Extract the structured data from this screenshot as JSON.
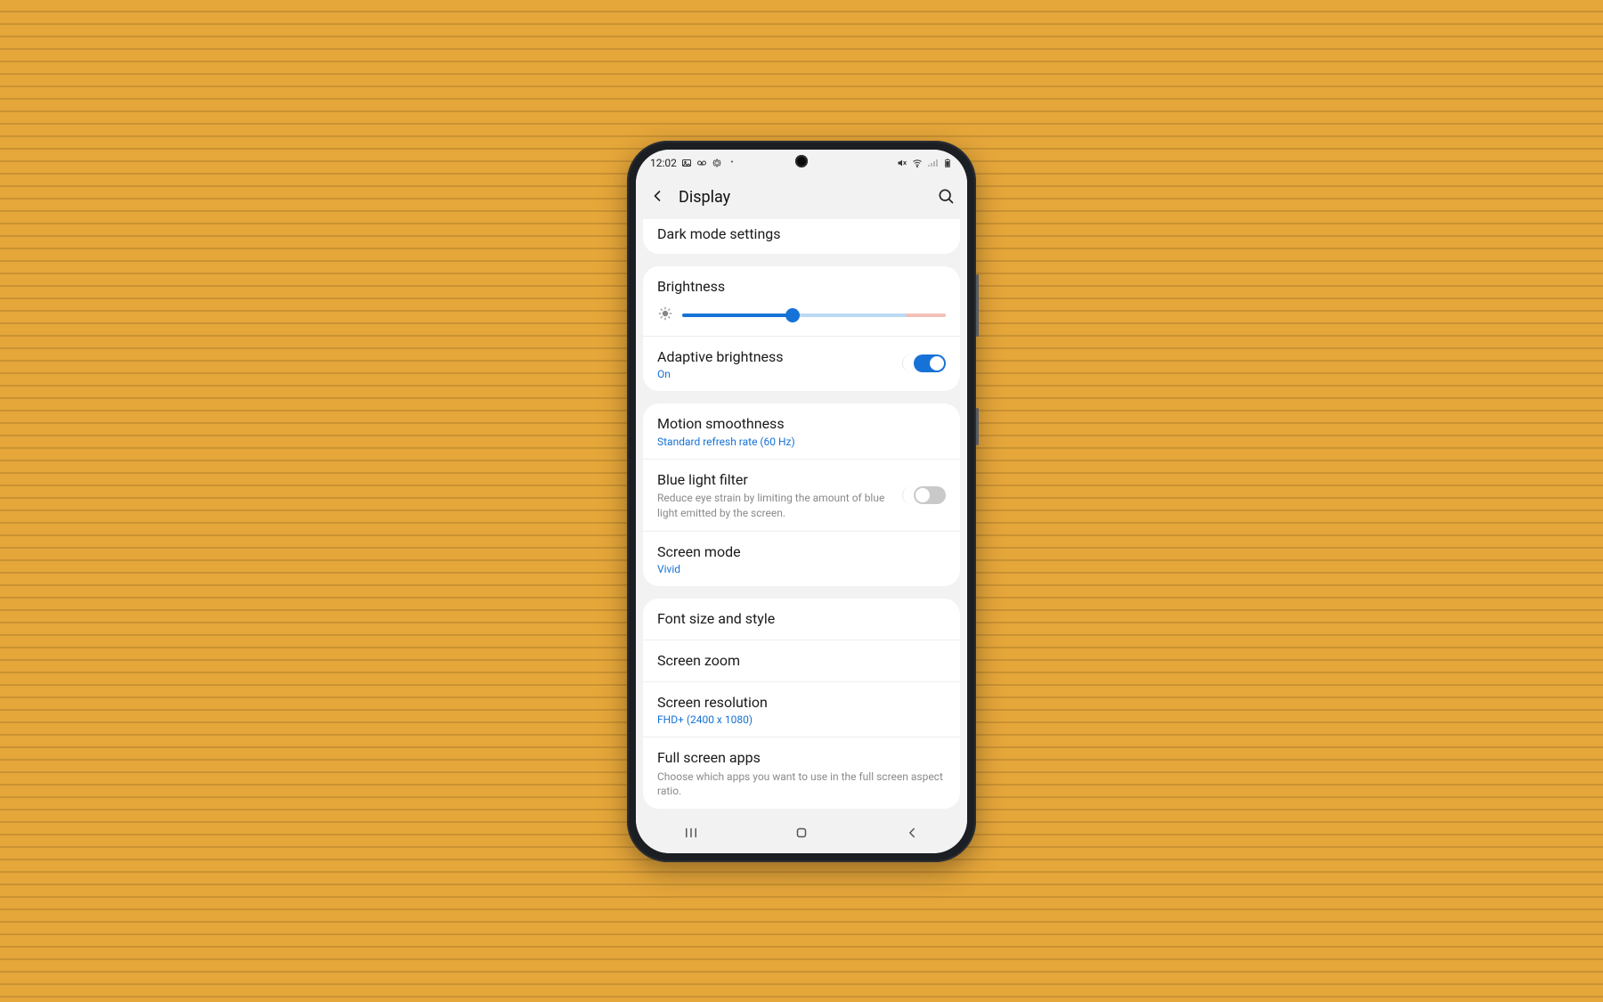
{
  "status": {
    "time": "12:02",
    "left_icons": [
      "image-icon",
      "voicemail-icon",
      "gear-icon",
      "dot-icon"
    ],
    "right_icons": [
      "mute-icon",
      "wifi-icon",
      "signal-icon",
      "battery-icon"
    ]
  },
  "header": {
    "title": "Display"
  },
  "sections": [
    {
      "card": "dark",
      "rows": [
        {
          "id": "dark-mode-settings",
          "title": "Dark mode settings"
        }
      ]
    },
    {
      "card": "brightness",
      "rows": [
        {
          "id": "brightness",
          "title": "Brightness",
          "kind": "slider",
          "value_pct": 42
        },
        {
          "id": "adaptive-brightness",
          "title": "Adaptive brightness",
          "sub_blue": "On",
          "kind": "toggle",
          "on": true
        }
      ]
    },
    {
      "card": "display",
      "rows": [
        {
          "id": "motion-smoothness",
          "title": "Motion smoothness",
          "sub_blue": "Standard refresh rate (60 Hz)"
        },
        {
          "id": "blue-light-filter",
          "title": "Blue light filter",
          "sub_gray": "Reduce eye strain by limiting the amount of blue light emitted by the screen.",
          "kind": "toggle",
          "on": false
        },
        {
          "id": "screen-mode",
          "title": "Screen mode",
          "sub_blue": "Vivid"
        }
      ]
    },
    {
      "card": "appearance",
      "rows": [
        {
          "id": "font-size-style",
          "title": "Font size and style"
        },
        {
          "id": "screen-zoom",
          "title": "Screen zoom"
        },
        {
          "id": "screen-resolution",
          "title": "Screen resolution",
          "sub_blue": "FHD+ (2400 x 1080)"
        },
        {
          "id": "full-screen-apps",
          "title": "Full screen apps",
          "sub_gray": "Choose which apps you want to use in the full screen aspect ratio."
        }
      ]
    }
  ],
  "colors": {
    "accent": "#1672d6",
    "bg": "#f2f2f2",
    "card": "#ffffff"
  }
}
